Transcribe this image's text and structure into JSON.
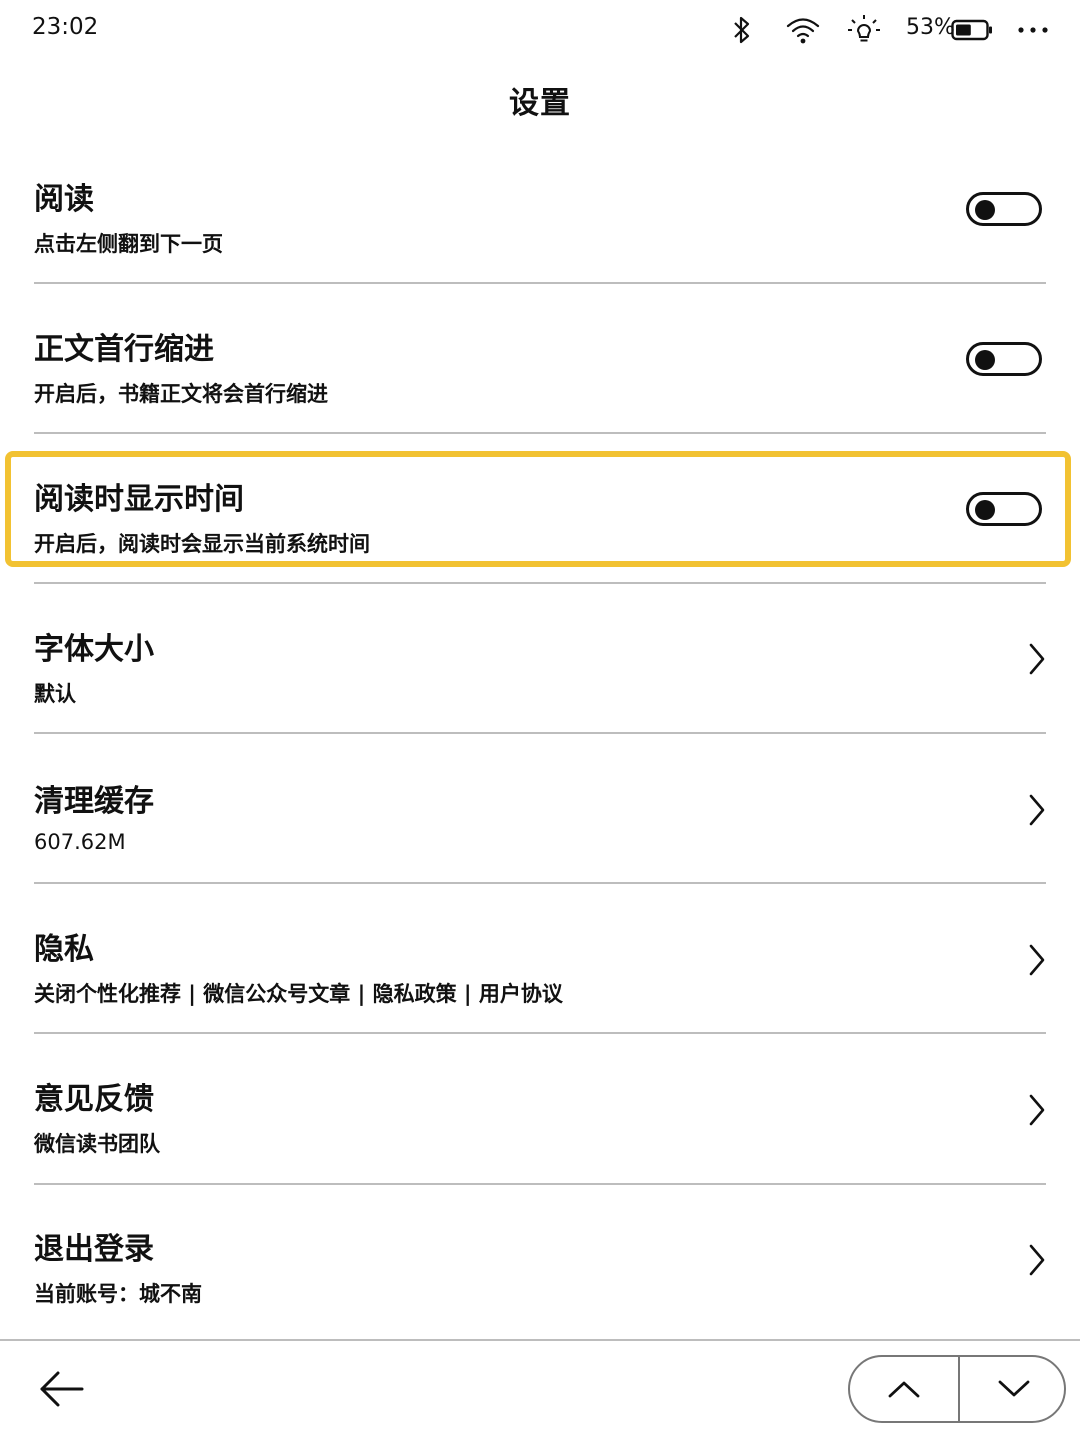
{
  "status_bar": {
    "time": "23:02",
    "battery_percent": "53%",
    "battery_level": 0.53,
    "icons": [
      "bluetooth-icon",
      "wifi-icon",
      "frontlight-icon",
      "battery-icon",
      "more-icon"
    ]
  },
  "page": {
    "title": "设置"
  },
  "settings": [
    {
      "title": "阅读",
      "subtitle": "点击左侧翻到下一页",
      "control": "toggle",
      "on": false
    },
    {
      "title": "正文首行缩进",
      "subtitle": "开启后，书籍正文将会首行缩进",
      "control": "toggle",
      "on": false
    },
    {
      "title": "阅读时显示时间",
      "subtitle": "开启后，阅读时会显示当前系统时间",
      "control": "toggle",
      "on": false,
      "highlighted": true
    },
    {
      "title": "字体大小",
      "subtitle": "默认",
      "control": "chevron"
    },
    {
      "title": "清理缓存",
      "subtitle": "607.62M",
      "control": "chevron"
    },
    {
      "title": "隐私",
      "subtitle": "关闭个性化推荐 | 微信公众号文章 | 隐私政策 | 用户协议",
      "control": "chevron"
    },
    {
      "title": "意见反馈",
      "subtitle": "微信读书团队",
      "control": "chevron"
    },
    {
      "title": "退出登录",
      "subtitle": "当前账号：城不南",
      "control": "chevron"
    }
  ],
  "colors": {
    "highlight": "#f2c232",
    "divider": "#bdbdbd",
    "text": "#111111"
  },
  "bottom_bar": {
    "icons": [
      "back-arrow-icon",
      "page-up-icon",
      "page-down-icon"
    ]
  }
}
